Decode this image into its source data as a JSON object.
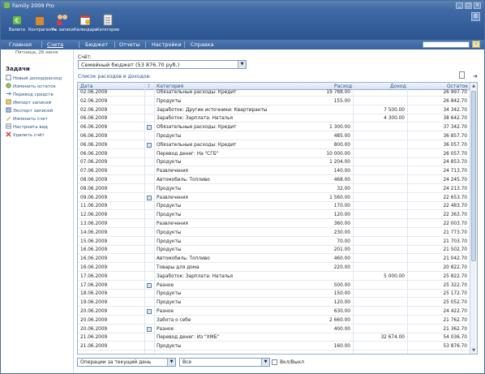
{
  "window": {
    "title": "Family 2009 Pro"
  },
  "toolbar": {
    "items": [
      {
        "label": "Валюта"
      },
      {
        "label": "Контрагенты"
      },
      {
        "label": "Уч. записи"
      },
      {
        "label": "Календарь"
      },
      {
        "label": "Категории"
      }
    ]
  },
  "menu": {
    "items": [
      {
        "label": "Главная"
      },
      {
        "label": "Счета"
      },
      {
        "label": "Бюджет"
      },
      {
        "label": "Отчеты"
      },
      {
        "label": "Настройки"
      },
      {
        "label": "Справка"
      }
    ],
    "active": "Счета"
  },
  "sidebar": {
    "date": "Пятница, 26 июня",
    "tasks_title": "Задачи",
    "tasks": [
      {
        "label": "Новый доход/расход"
      },
      {
        "label": "Изменить остаток"
      },
      {
        "label": "Перевод средств"
      },
      {
        "label": "Импорт записей"
      },
      {
        "label": "Экспорт записей"
      },
      {
        "label": "Изменить счет"
      },
      {
        "label": "Настроить вид"
      },
      {
        "label": "Удалить счёт"
      }
    ]
  },
  "main": {
    "account_label": "Счёт:",
    "account_value": "Семейный бюджет (53 876.70 руб.)",
    "list_label": "Список расходов и доходов:",
    "columns": {
      "date": "Дата",
      "note": "!",
      "category": "Категория",
      "expense": "Расход",
      "income": "Доход",
      "balance": "Остаток"
    },
    "rows": [
      {
        "date": "02.06.2009",
        "note": false,
        "category": "Обязательные расходы: Кредит",
        "expense": "19 788.00",
        "income": "",
        "balance": "26 997.70"
      },
      {
        "date": "02.06.2009",
        "note": false,
        "category": "Продукты",
        "expense": "155.00",
        "income": "",
        "balance": "26 842.70"
      },
      {
        "date": "02.06.2009",
        "note": false,
        "category": "Заработок: Другие источники: Квартиранты",
        "expense": "",
        "income": "7 500.00",
        "balance": "34 342.70"
      },
      {
        "date": "06.06.2009",
        "note": false,
        "category": "Заработок: Зарплата: Наталья",
        "expense": "",
        "income": "4 300.00",
        "balance": "38 642.70"
      },
      {
        "date": "06.06.2009",
        "note": true,
        "category": "Обязательные расходы: Кредит",
        "expense": "1 300.00",
        "income": "",
        "balance": "37 342.70"
      },
      {
        "date": "06.06.2009",
        "note": false,
        "category": "Продукты",
        "expense": "485.00",
        "income": "",
        "balance": "36 857.70"
      },
      {
        "date": "06.06.2009",
        "note": true,
        "category": "Обязательные расходы: Кредит",
        "expense": "800.00",
        "income": "",
        "balance": "36 057.70"
      },
      {
        "date": "06.06.2009",
        "note": false,
        "category": "Перевод денег: На \"СГБ\"",
        "expense": "10 000.00",
        "income": "",
        "balance": "26 057.70"
      },
      {
        "date": "07.06.2009",
        "note": false,
        "category": "Продукты",
        "expense": "1 204.00",
        "income": "",
        "balance": "24 853.70"
      },
      {
        "date": "07.06.2009",
        "note": false,
        "category": "Развлечения",
        "expense": "140.00",
        "income": "",
        "balance": "24 713.70"
      },
      {
        "date": "08.06.2009",
        "note": false,
        "category": "Автомобиль: Топливо",
        "expense": "468.00",
        "income": "",
        "balance": "24 245.70"
      },
      {
        "date": "08.06.2009",
        "note": false,
        "category": "Продукты",
        "expense": "32.00",
        "income": "",
        "balance": "24 213.70"
      },
      {
        "date": "09.06.2009",
        "note": true,
        "category": "Развлечения",
        "expense": "1 560.00",
        "income": "",
        "balance": "22 653.70"
      },
      {
        "date": "11.06.2009",
        "note": false,
        "category": "Продукты",
        "expense": "170.00",
        "income": "",
        "balance": "22 483.70"
      },
      {
        "date": "12.06.2009",
        "note": false,
        "category": "Продукты",
        "expense": "120.00",
        "income": "",
        "balance": "22 363.70"
      },
      {
        "date": "13.06.2009",
        "note": false,
        "category": "Развлечения",
        "expense": "360.00",
        "income": "",
        "balance": "22 003.70"
      },
      {
        "date": "14.06.2009",
        "note": false,
        "category": "Продукты",
        "expense": "230.00",
        "income": "",
        "balance": "21 773.70"
      },
      {
        "date": "15.06.2009",
        "note": false,
        "category": "Продукты",
        "expense": "70.00",
        "income": "",
        "balance": "21 703.70"
      },
      {
        "date": "16.06.2009",
        "note": false,
        "category": "Продукты",
        "expense": "201.00",
        "income": "",
        "balance": "21 502.70"
      },
      {
        "date": "16.06.2009",
        "note": false,
        "category": "Автомобиль: Топливо",
        "expense": "460.00",
        "income": "",
        "balance": "21 042.70"
      },
      {
        "date": "16.06.2009",
        "note": false,
        "category": "Товары для дома",
        "expense": "220.00",
        "income": "",
        "balance": "20 822.70"
      },
      {
        "date": "17.06.2009",
        "note": false,
        "category": "Заработок: Зарплата: Наталья",
        "expense": "",
        "income": "5 000.00",
        "balance": "25 822.70"
      },
      {
        "date": "17.06.2009",
        "note": true,
        "category": "Разное",
        "expense": "500.00",
        "income": "",
        "balance": "25 322.70"
      },
      {
        "date": "18.06.2009",
        "note": false,
        "category": "Продукты",
        "expense": "150.00",
        "income": "",
        "balance": "25 172.70"
      },
      {
        "date": "19.06.2009",
        "note": false,
        "category": "Продукты",
        "expense": "120.00",
        "income": "",
        "balance": "25 052.70"
      },
      {
        "date": "20.06.2009",
        "note": true,
        "category": "Разное",
        "expense": "630.00",
        "income": "",
        "balance": "24 422.70"
      },
      {
        "date": "20.06.2009",
        "note": false,
        "category": "Забота о себе",
        "expense": "2 660.00",
        "income": "",
        "balance": "21 762.70"
      },
      {
        "date": "20.06.2009",
        "note": true,
        "category": "Разное",
        "expense": "400.00",
        "income": "",
        "balance": "21 362.70"
      },
      {
        "date": "21.06.2009",
        "note": false,
        "category": "Перевод денег: Из \"ХМБ\"",
        "expense": "",
        "income": "32 674.00",
        "balance": "54 036.70"
      },
      {
        "date": "21.06.2009",
        "note": false,
        "category": "Продукты",
        "expense": "160.00",
        "income": "",
        "balance": "53 876.70"
      }
    ]
  },
  "bottom": {
    "period_value": "Операции за текущий день",
    "filter_value": "Все",
    "toggle_label": "Вкл/Выкл"
  }
}
